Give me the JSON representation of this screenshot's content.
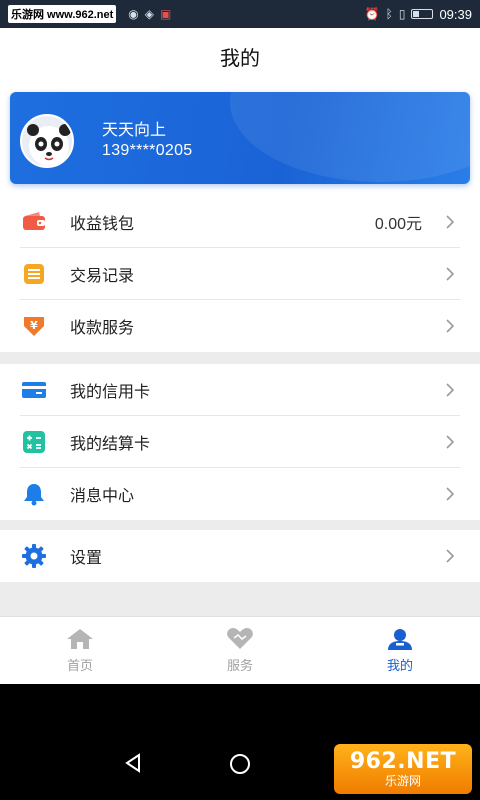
{
  "status_bar": {
    "watermark": "乐游网 www.962.net",
    "time": "09:39"
  },
  "header": {
    "title": "我的"
  },
  "profile": {
    "name": "天天向上",
    "phone": "139****0205"
  },
  "menu_group_1": [
    {
      "label": "收益钱包",
      "value": "0.00元",
      "icon": "wallet-icon",
      "color": "#ef5b45"
    },
    {
      "label": "交易记录",
      "icon": "record-icon",
      "color": "#f5a623"
    },
    {
      "label": "收款服务",
      "icon": "yuan-down-icon",
      "color": "#f07a2a"
    }
  ],
  "menu_group_2": [
    {
      "label": "我的信用卡",
      "icon": "credit-card-icon",
      "color": "#1e7ee8"
    },
    {
      "label": "我的结算卡",
      "icon": "calculator-icon",
      "color": "#22c2a0"
    },
    {
      "label": "消息中心",
      "icon": "bell-icon",
      "color": "#1e7ee8"
    }
  ],
  "menu_group_3": [
    {
      "label": "设置",
      "icon": "gear-icon",
      "color": "#1e6fe0"
    }
  ],
  "bottom_nav": {
    "items": [
      {
        "label": "首页",
        "icon": "home-icon",
        "active": false
      },
      {
        "label": "服务",
        "icon": "heart-icon",
        "active": false
      },
      {
        "label": "我的",
        "icon": "user-icon",
        "active": true
      }
    ]
  },
  "brand_watermark": {
    "main": "962.NET",
    "sub": "乐游网"
  },
  "colors": {
    "primary": "#1a63d6",
    "inactive": "#a0a0a0"
  }
}
